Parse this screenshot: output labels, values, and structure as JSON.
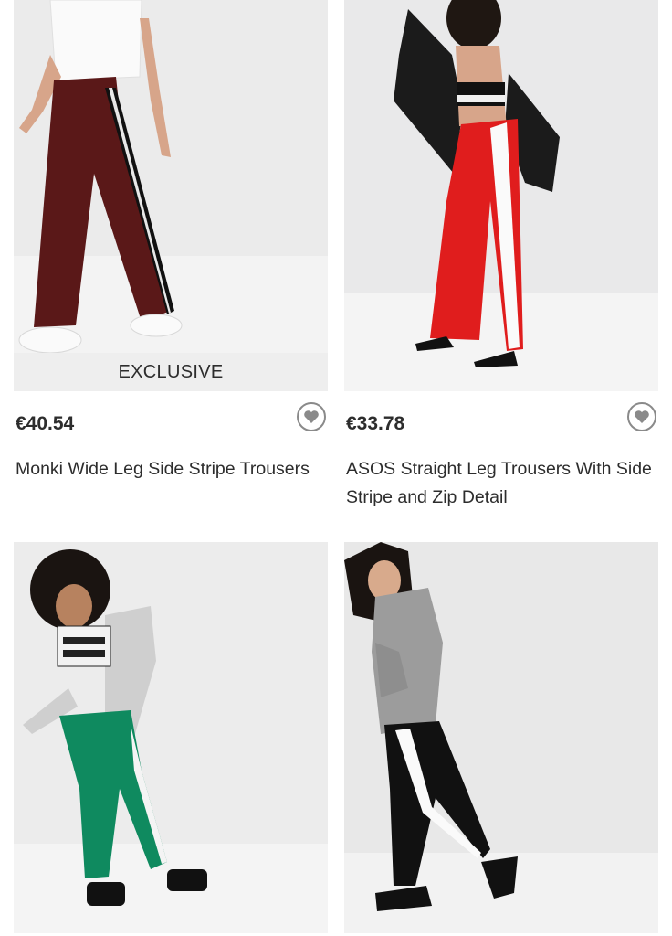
{
  "products": [
    {
      "price": "€40.54",
      "title": "Monki Wide Leg Side Stripe Trousers",
      "badge": "EXCLUSIVE"
    },
    {
      "price": "€33.78",
      "title": "ASOS Straight Leg Trousers With Side Stripe and Zip Detail"
    },
    {
      "price": "",
      "title": ""
    },
    {
      "price": "",
      "title": ""
    }
  ],
  "icons": {
    "save": "heart-icon"
  },
  "colors": {
    "text": "#2d2d2d",
    "heart": "#8a8a8a",
    "badge_bg": "#eeeeee"
  }
}
